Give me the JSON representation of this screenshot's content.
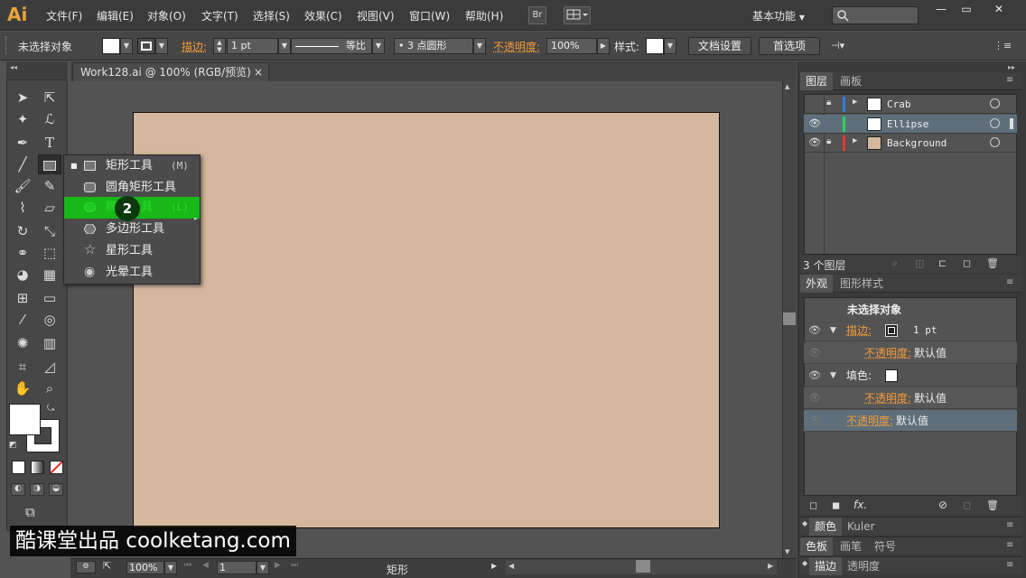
{
  "app": {
    "logo": "Ai",
    "workspace": "基本功能",
    "br_label": "Br"
  },
  "menu": [
    "文件(F)",
    "编辑(E)",
    "对象(O)",
    "文字(T)",
    "选择(S)",
    "效果(C)",
    "视图(V)",
    "窗口(W)",
    "帮助(H)"
  ],
  "window_controls": {
    "min": "—",
    "max": "▭",
    "close": "✕"
  },
  "control_bar": {
    "selection": "未选择对象",
    "stroke_label": "描边:",
    "stroke_weight": "1 pt",
    "profile": "等比",
    "brush": "• 3 点圆形",
    "opacity_label": "不透明度:",
    "opacity_value": "100%",
    "style_label": "样式:",
    "doc_setup": "文档设置",
    "preferences": "首选项"
  },
  "document": {
    "tab_title": "Work128.ai @ 100% (RGB/预览)",
    "tab_close": "×",
    "artboard_color": "#d4b79c"
  },
  "status_bar": {
    "zoom": "100%",
    "page": "1",
    "label": "矩形"
  },
  "flyout": {
    "items": [
      {
        "label": "矩形工具",
        "key": "(M)",
        "icon": "rectangle-icon",
        "current": true
      },
      {
        "label": "圆角矩形工具",
        "key": "",
        "icon": "rounded-rectangle-icon"
      },
      {
        "label": "椭圆工具",
        "key": "(L)",
        "icon": "ellipse-icon",
        "highlighted": true
      },
      {
        "label": "多边形工具",
        "key": "",
        "icon": "polygon-icon"
      },
      {
        "label": "星形工具",
        "key": "",
        "icon": "star-icon"
      },
      {
        "label": "光晕工具",
        "key": "",
        "icon": "flare-icon"
      }
    ],
    "step_badge": "2",
    "highlight_color": "#17b817"
  },
  "layers_panel": {
    "tabs": [
      "图层",
      "画板"
    ],
    "layers": [
      {
        "name": "Crab",
        "color": "#2f7de0",
        "locked": true,
        "visible": false,
        "expandable": true,
        "thumb": "#ffffff"
      },
      {
        "name": "Ellipse",
        "color": "#2fd35a",
        "locked": false,
        "visible": true,
        "expandable": false,
        "selected": true,
        "thumb": "#ffffff"
      },
      {
        "name": "Background",
        "color": "#e03a3a",
        "locked": true,
        "visible": true,
        "expandable": true,
        "thumb": "#d4b79c"
      }
    ],
    "count": "3 个图层"
  },
  "appearance_panel": {
    "tabs": [
      "外观",
      "图形样式"
    ],
    "title": "未选择对象",
    "stroke_label": "描边:",
    "stroke_value": "1 pt",
    "opacity_label": "不透明度:",
    "default_value": "默认值",
    "fill_label": "填色:"
  },
  "collapsed_panels": [
    [
      "颜色",
      "Kuler"
    ],
    [
      "色板",
      "画笔",
      "符号"
    ],
    [
      "描边",
      "透明度"
    ]
  ],
  "watermark": "酷课堂出品 coolketang.com"
}
